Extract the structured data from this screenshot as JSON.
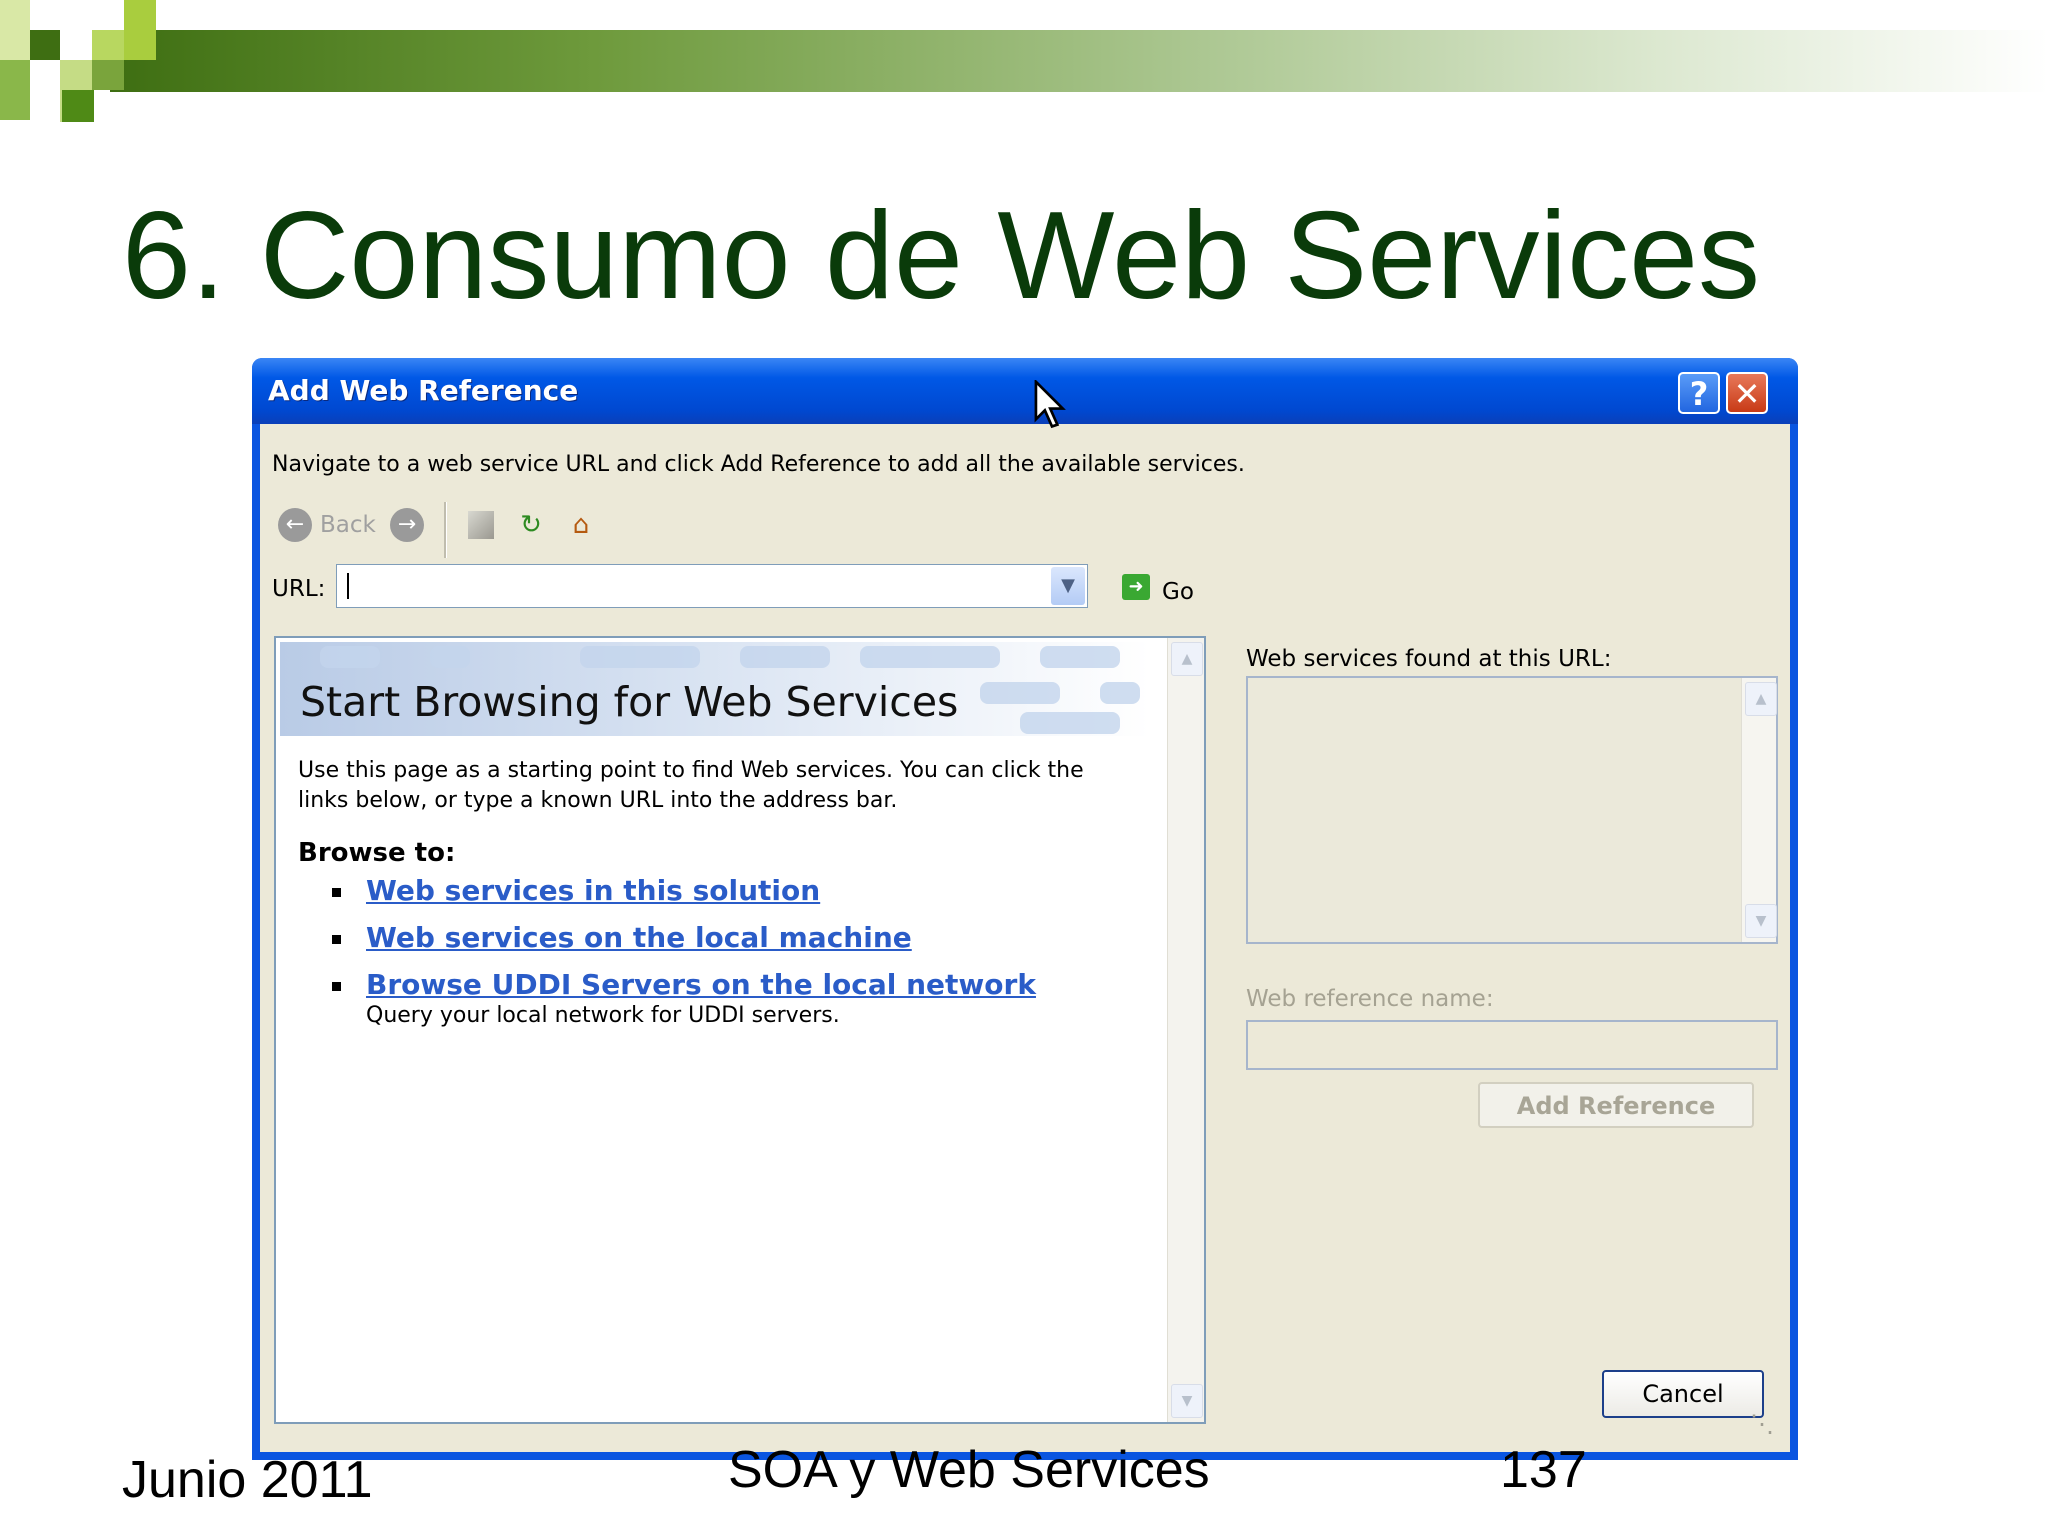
{
  "slide": {
    "title": "6. Consumo de Web Services",
    "footer_date": "Junio 2011",
    "footer_center": "SOA y Web Services",
    "footer_page": "137"
  },
  "dialog": {
    "title": "Add Web Reference",
    "help_label": "?",
    "close_label": "✕",
    "instruction": "Navigate to a web service URL and click Add Reference to add all the available services.",
    "toolbar": {
      "back_label": "Back",
      "back_icon": "back-arrow-icon",
      "forward_icon": "forward-arrow-icon",
      "stop_icon": "stop-page-icon",
      "refresh_icon": "refresh-icon",
      "home_icon": "home-icon"
    },
    "url": {
      "label": "URL:",
      "value": "",
      "go_label": "Go"
    },
    "browser": {
      "heading": "Start Browsing for Web Services",
      "intro": "Use this page as a starting point to find Web services. You can click the links below, or type a known URL into the address bar.",
      "browse_to": "Browse to:",
      "links": [
        {
          "text": "Web services in this solution"
        },
        {
          "text": "Web services on the local machine"
        },
        {
          "text": "Browse UDDI Servers on the local network",
          "sub": "Query your local network for UDDI servers."
        }
      ]
    },
    "found": {
      "label": "Web services found at this URL:",
      "items": []
    },
    "ref_name": {
      "label": "Web reference name:",
      "value": ""
    },
    "add_reference_label": "Add Reference",
    "cancel_label": "Cancel"
  },
  "colors": {
    "title_green": "#0a3b0a",
    "titlebar_blue": "#0058e6",
    "dialog_face": "#ece9d8",
    "link_blue": "#2a5cc8"
  }
}
